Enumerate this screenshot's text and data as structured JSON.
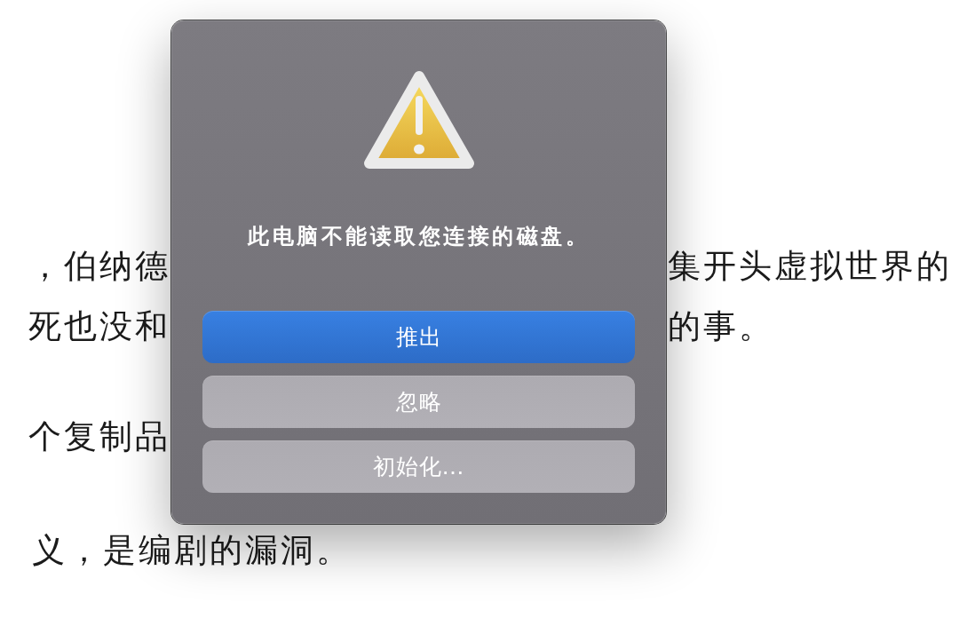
{
  "article_text": {
    "lines": [
      {
        "kind": "split",
        "left": "，伯纳德",
        "right": "集开头虚拟世界的"
      },
      {
        "kind": "split",
        "left": "死也没和",
        "right": "的事。"
      },
      {
        "kind": "split",
        "left": "个复制品"
      },
      {
        "kind": "plain",
        "left": "义，是编剧的漏洞。"
      }
    ]
  },
  "alert": {
    "message": "此电脑不能读取您连接的磁盘。",
    "buttons": [
      {
        "label": "推出",
        "default": true
      },
      {
        "label": "忽略",
        "default": false
      },
      {
        "label": "初始化…",
        "default": false
      }
    ]
  }
}
